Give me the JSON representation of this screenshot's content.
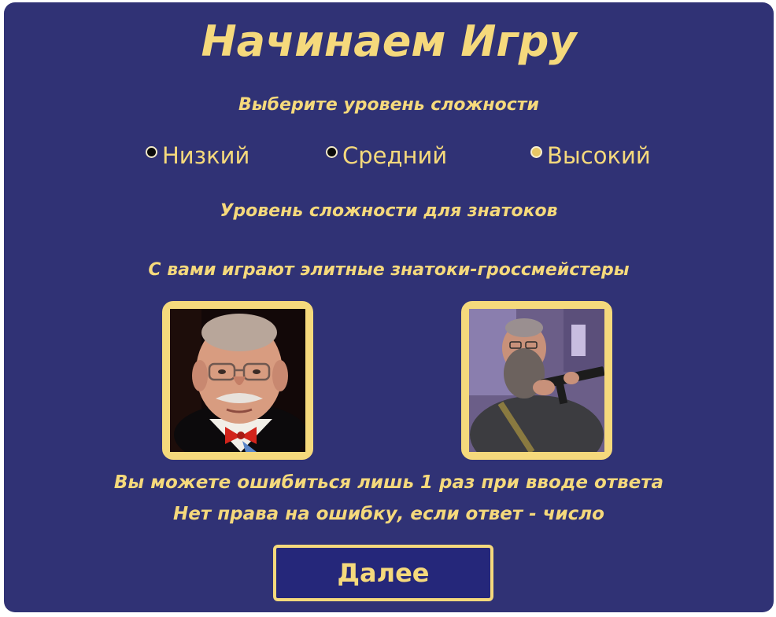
{
  "title": "Начинаем Игру",
  "difficulty": {
    "prompt": "Выберите уровень сложности",
    "options": [
      {
        "label": "Низкий",
        "selected": false
      },
      {
        "label": "Средний",
        "selected": false
      },
      {
        "label": "Высокий",
        "selected": true
      }
    ],
    "description": "Уровень сложности для знатоков",
    "players_text": "С вами играют элитные знатоки-гроссмейстеры"
  },
  "rules": {
    "line1": "Вы можете ошибиться лишь 1 раз при вводе ответа",
    "line2": "Нет права на ошибку, если ответ - число"
  },
  "next_button": {
    "label": "Далее"
  },
  "colors": {
    "background": "#303275",
    "accent": "#f5d97c",
    "button_bg": "#25277a"
  }
}
